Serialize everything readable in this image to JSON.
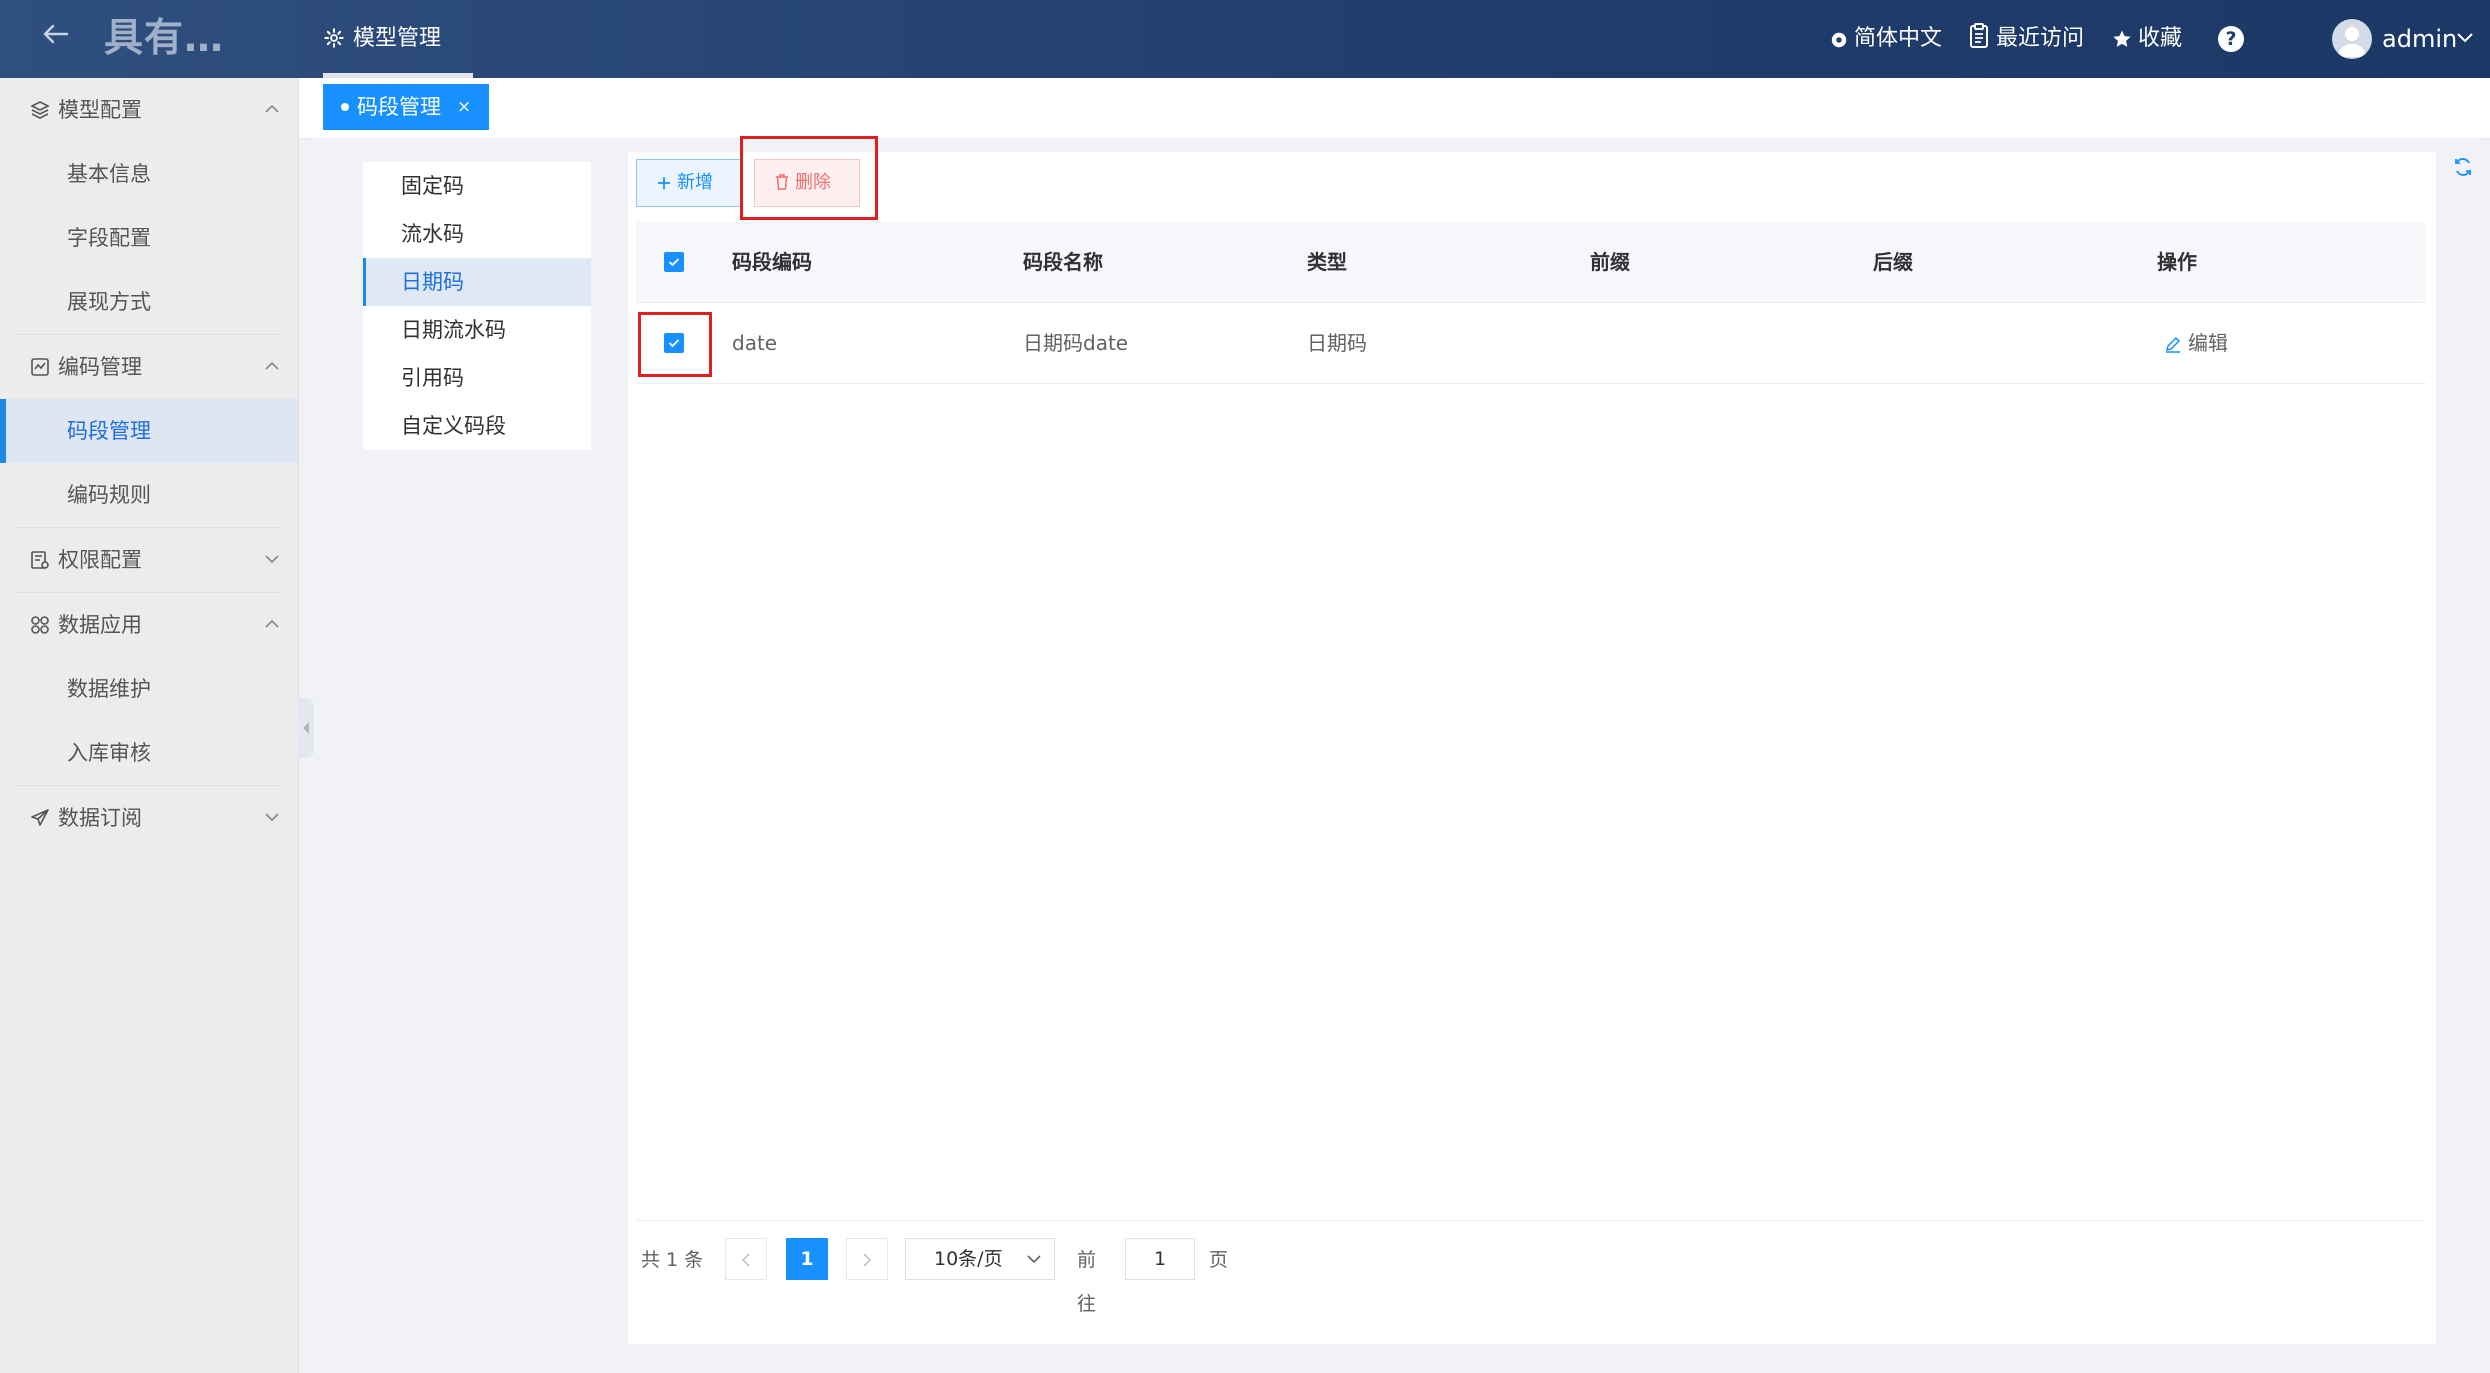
{
  "header": {
    "app_title": "具有…",
    "active_module": "模型管理",
    "language": "简体中文",
    "recent": "最近访问",
    "favorites": "收藏",
    "help": "?",
    "username": "admin"
  },
  "sidebar": {
    "groups": [
      {
        "label": "模型配置",
        "items": [
          "基本信息",
          "字段配置",
          "展现方式"
        ]
      },
      {
        "label": "编码管理",
        "items": [
          "码段管理",
          "编码规则"
        ]
      },
      {
        "label": "权限配置"
      },
      {
        "label": "数据应用",
        "items": [
          "数据维护",
          "入库审核"
        ]
      },
      {
        "label": "数据订阅"
      }
    ],
    "active_item": "码段管理"
  },
  "tabs": {
    "open": [
      {
        "label": "码段管理",
        "close": "×"
      }
    ]
  },
  "segment_types": [
    "固定码",
    "流水码",
    "日期码",
    "日期流水码",
    "引用码",
    "自定义码段"
  ],
  "segment_types_active": "日期码",
  "toolbar": {
    "add_label": "新增",
    "delete_label": "删除"
  },
  "table": {
    "columns": [
      "码段编码",
      "码段名称",
      "类型",
      "前缀",
      "后缀",
      "操作"
    ],
    "rows": [
      {
        "checked": true,
        "code": "date",
        "name": "日期码date",
        "type": "日期码",
        "prefix": "",
        "suffix": "",
        "action": "编辑"
      }
    ],
    "header_checked": true
  },
  "pagination": {
    "total_text": "共 1 条",
    "current_page": "1",
    "page_size": "10条/页",
    "goto_label": "前往",
    "goto_value": "1",
    "page_unit": "页"
  },
  "colors": {
    "header_bg": "#1f3d6d",
    "accent": "#1890ff",
    "danger": "#f56c6c",
    "highlight_box": "#e02020"
  }
}
